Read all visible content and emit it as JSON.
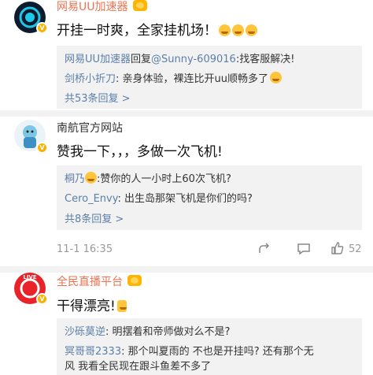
{
  "comments": [
    {
      "name": "网易UU加速器",
      "text": "开挂一时爽，全家挂机场！",
      "replies": [
        {
          "user": "网易UU加速器",
          "connector": "回复",
          "mention": "@Sunny-609016",
          "text": ":找客服解决!"
        },
        {
          "user": "剑桥小折刀",
          "text": ": 亲身体验，裸连比开uu顺畅多了"
        }
      ],
      "more": "共53条回复 >"
    },
    {
      "name": "南航官方网站",
      "text": "赞我一下，，，多做一次飞机!",
      "replies": [
        {
          "user": "桐乃",
          "text": ":赞你的人一小时上60次飞机?"
        },
        {
          "user": "Cero_Envy",
          "text": ": 出生岛那架飞机是你们的吗?"
        }
      ],
      "more": "共8条回复 >",
      "time": "11-1 16:35",
      "likes": "52"
    },
    {
      "name": "全民直播平台",
      "text": "干得漂亮!",
      "avatar_label": "LIVE",
      "replies": [
        {
          "user": "沙砾莫逆",
          "text": ": 明摆着和帝师做对么不是?"
        },
        {
          "user": "冥哥哥2333",
          "text": ": 那个叫夏雨的  不也是开挂吗? 还有那个无"
        },
        {
          "user": "",
          "text": "风 我看全民现在跟斗鱼差不多了"
        }
      ]
    }
  ],
  "colors": {
    "vip_name": "#eb7350",
    "link": "#5b7fa8",
    "verified": "#f9b200"
  }
}
